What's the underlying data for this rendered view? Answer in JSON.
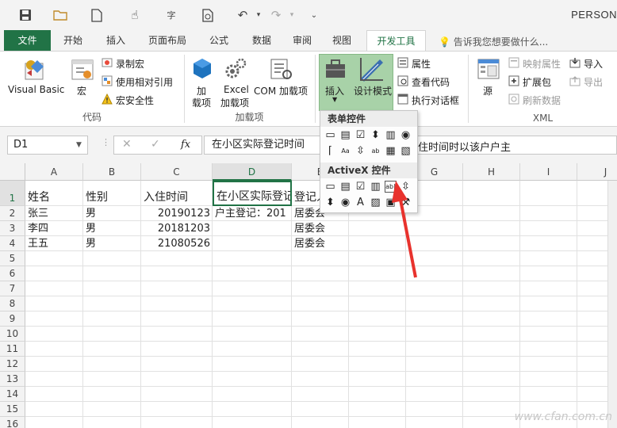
{
  "window": {
    "title": "PERSON"
  },
  "tabs": [
    "文件",
    "开始",
    "插入",
    "页面布局",
    "公式",
    "数据",
    "审阅",
    "视图",
    "开发工具"
  ],
  "tell_me": "告诉我您想要做什么...",
  "ribbon": {
    "code": {
      "group_label": "代码",
      "visual_basic": "Visual Basic",
      "macros": "宏",
      "record_macro": "录制宏",
      "relative_ref": "使用相对引用",
      "macro_security": "宏安全性"
    },
    "addins": {
      "group_label": "加载项",
      "addins_line1": "加",
      "addins_line2": "载项",
      "excel_addins_line1": "Excel",
      "excel_addins_line2": "加载项",
      "com_addins": "COM 加载项"
    },
    "controls": {
      "insert": "插入",
      "design_mode": "设计模式",
      "properties": "属性",
      "view_code": "查看代码",
      "run_dialog": "执行对话框"
    },
    "xml": {
      "group_label": "XML",
      "source": "源",
      "map_properties": "映射属性",
      "expansion_packs": "扩展包",
      "refresh_data": "刷新数据",
      "import": "导入",
      "export": "导出"
    }
  },
  "formula_bar": {
    "name_box": "D1",
    "fx": "fx",
    "content": "在小区实际登记时间",
    "content_tail": "住时间时以该户户主"
  },
  "dropdown": {
    "form_controls": "表单控件",
    "activex_controls": "ActiveX 控件"
  },
  "columns": [
    "A",
    "B",
    "C",
    "D",
    "E",
    "F",
    "G",
    "H",
    "I",
    "J"
  ],
  "rows": [
    [
      "姓名",
      "性别",
      "入住时间",
      "在小区实际登记",
      "登记人",
      "",
      "",
      "",
      "",
      ""
    ],
    [
      "张三",
      "男",
      "20190123",
      "户主登记：201",
      "居委会",
      "",
      "",
      "",
      "",
      ""
    ],
    [
      "李四",
      "男",
      "20181203",
      "",
      "居委会",
      "",
      "",
      "",
      "",
      ""
    ],
    [
      "王五",
      "男",
      "21080526",
      "",
      "居委会",
      "",
      "",
      "",
      "",
      ""
    ]
  ],
  "row_count": 16,
  "watermark": "www.cfan.com.cn",
  "colors": {
    "excel_green": "#217346",
    "arrow_red": "#e8322d"
  }
}
